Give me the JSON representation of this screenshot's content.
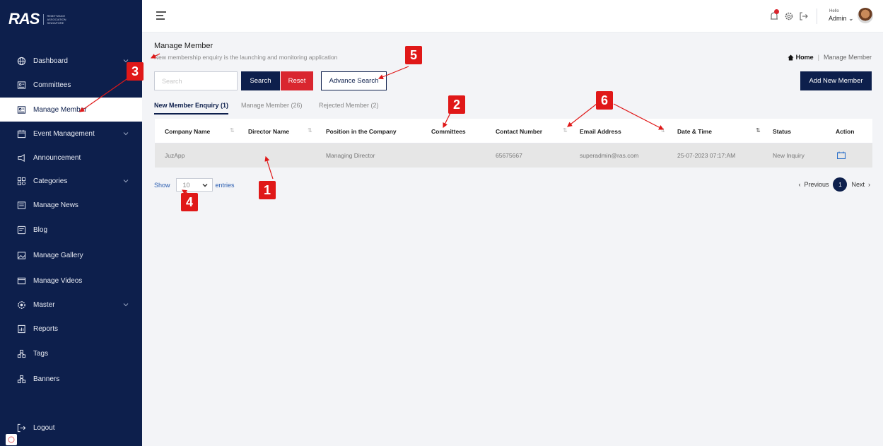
{
  "logo": {
    "mark": "RAS",
    "text": "REMITTANCE ASSOCIATION SINGAPORE"
  },
  "sidebar": {
    "items": [
      {
        "label": "Dashboard",
        "icon": "globe-icon",
        "chevron": true
      },
      {
        "label": "Committees",
        "icon": "id-card-icon",
        "chevron": false
      },
      {
        "label": "Manage Member",
        "icon": "id-card-icon",
        "chevron": false,
        "active": true
      },
      {
        "label": "Event Management",
        "icon": "calendar-icon",
        "chevron": true
      },
      {
        "label": "Announcement",
        "icon": "megaphone-icon",
        "chevron": false
      },
      {
        "label": "Categories",
        "icon": "categories-icon",
        "chevron": true
      },
      {
        "label": "Manage News",
        "icon": "news-icon",
        "chevron": false
      },
      {
        "label": "Blog",
        "icon": "blog-icon",
        "chevron": false
      },
      {
        "label": "Manage Gallery",
        "icon": "gallery-icon",
        "chevron": false
      },
      {
        "label": "Manage Videos",
        "icon": "video-icon",
        "chevron": false
      },
      {
        "label": "Master",
        "icon": "master-icon",
        "chevron": true
      },
      {
        "label": "Reports",
        "icon": "reports-icon",
        "chevron": false
      },
      {
        "label": "Tags",
        "icon": "tags-icon",
        "chevron": false
      },
      {
        "label": "Banners",
        "icon": "banners-icon",
        "chevron": false
      }
    ],
    "logout": "Logout"
  },
  "topbar": {
    "hello": "Hello",
    "user": "Admin"
  },
  "page": {
    "title": "Manage Member",
    "subtitle": "New membership enquiry is the launching and monitoring application",
    "breadcrumb": {
      "home": "Home",
      "current": "Manage Member"
    }
  },
  "toolbar": {
    "search_placeholder": "Search",
    "search_label": "Search",
    "reset_label": "Reset",
    "advanced_label": "Advance Search",
    "add_label": "Add New Member"
  },
  "tabs": [
    {
      "label": "New Member Enquiry (1)",
      "active": true
    },
    {
      "label": "Manage Member (26)",
      "active": false
    },
    {
      "label": "Rejected Member (2)",
      "active": false
    }
  ],
  "table": {
    "headers": [
      "Company Name",
      "Director Name",
      "Position in the Company",
      "Committees",
      "Contact Number",
      "Email Address",
      "Date & Time",
      "Status",
      "Action"
    ],
    "rows": [
      [
        "JuzApp",
        "",
        "Managing Director",
        "",
        "65675667",
        "superadmin@ras.com",
        "25-07-2023 07:17:AM",
        "New Inquiry",
        "view-icon"
      ]
    ]
  },
  "pager": {
    "show": "Show",
    "entries_value": "10",
    "entries": "entries",
    "previous": "Previous",
    "current_page": "1",
    "next": "Next"
  },
  "annotations": [
    "1",
    "2",
    "3",
    "4",
    "5",
    "6"
  ],
  "colors": {
    "navy": "#0d1f4c",
    "red": "#d9262f",
    "annotation": "#e01818"
  }
}
